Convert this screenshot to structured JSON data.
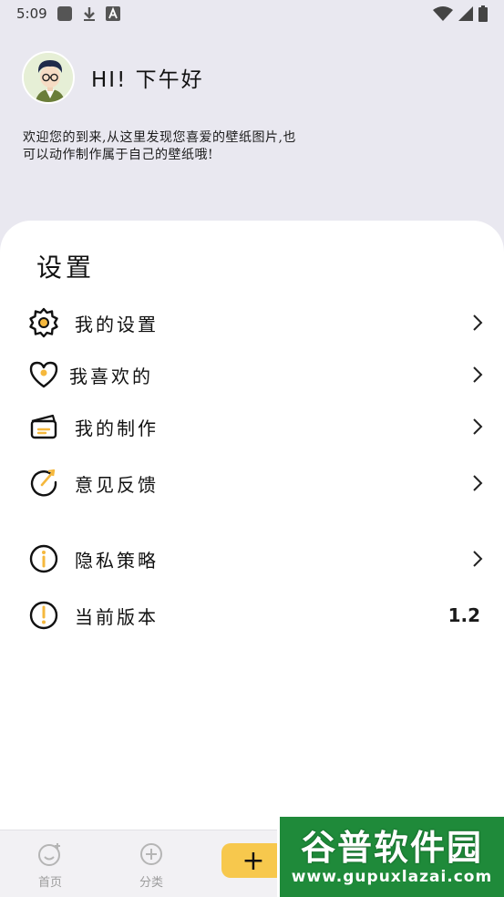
{
  "status_bar": {
    "time": "5:09"
  },
  "header": {
    "greeting": "HI! 下午好",
    "welcome": "欢迎您的到来,从这里发现您喜爱的壁纸图片,也可以动作制作属于自己的壁纸哦!"
  },
  "settings": {
    "title": "设置",
    "items": [
      {
        "label": "我的设置",
        "icon": "gear-icon"
      },
      {
        "label": "我喜欢的",
        "icon": "heart-icon"
      },
      {
        "label": "我的制作",
        "icon": "card-icon"
      },
      {
        "label": "意见反馈",
        "icon": "feedback-icon"
      },
      {
        "label": "隐私策略",
        "icon": "info-icon"
      },
      {
        "label": "当前版本",
        "icon": "alert-icon",
        "value": "1.2"
      }
    ]
  },
  "bottom_nav": {
    "items": [
      {
        "label": "首页"
      },
      {
        "label": "分类"
      }
    ],
    "add_label": "+"
  },
  "watermark": {
    "brand": "谷普软件园",
    "url": "www.gupuxlazai.com"
  },
  "colors": {
    "background": "#e9e8f0",
    "accent": "#f7c84d",
    "icon_accent": "#f5b83d",
    "watermark": "#1f8a3a"
  }
}
